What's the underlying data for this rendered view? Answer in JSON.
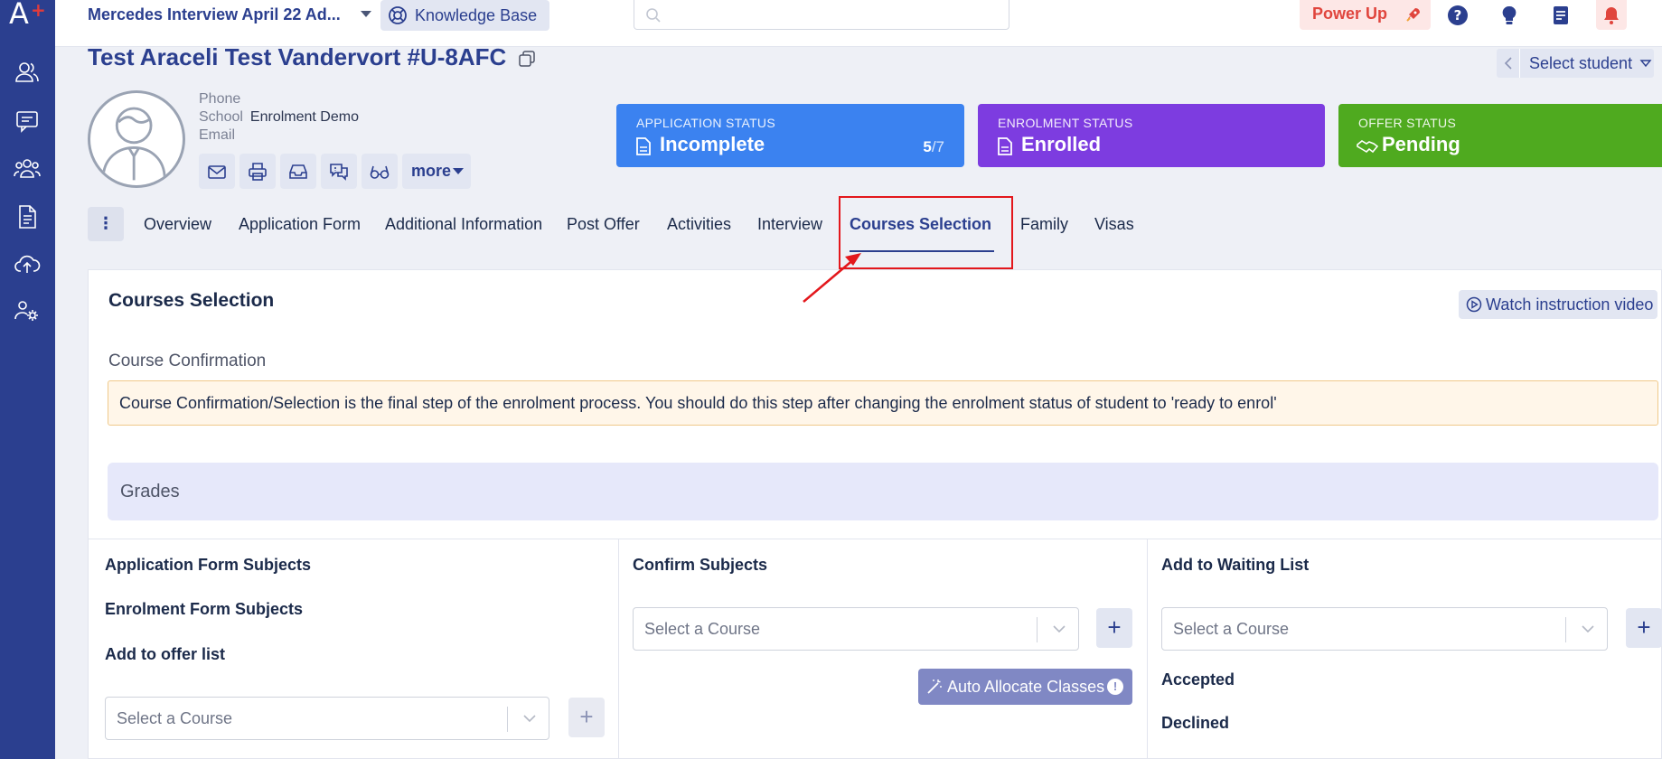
{
  "sidebar": {
    "logo": "A",
    "items": [
      "users-icon",
      "chat-icon",
      "group-icon",
      "document-icon",
      "cloud-upload-icon",
      "settings-users-icon"
    ]
  },
  "topbar": {
    "event_title": "Mercedes Interview April 22 Ad...",
    "knowledge_base": "Knowledge Base",
    "search_placeholder": "",
    "power_up": "Power Up"
  },
  "student": {
    "name": "Test Araceli Test Vandervort #U-8AFC",
    "select_student": "Select student",
    "phone_label": "Phone",
    "phone_value": "",
    "school_label": "School",
    "school_value": "Enrolment Demo",
    "email_label": "Email",
    "email_value": "",
    "more_label": "more"
  },
  "statuses": {
    "application": {
      "caption": "APPLICATION STATUS",
      "value": "Incomplete",
      "done": "5",
      "total": "/7",
      "color": "#3b82f0"
    },
    "enrolment": {
      "caption": "ENROLMENT STATUS",
      "value": "Enrolled",
      "color": "#7d3ce0"
    },
    "offer": {
      "caption": "OFFER STATUS",
      "value": "Pending",
      "color": "#4faa1f"
    }
  },
  "tabs": [
    {
      "label": "Overview"
    },
    {
      "label": "Application Form"
    },
    {
      "label": "Additional Information"
    },
    {
      "label": "Post Offer"
    },
    {
      "label": "Activities"
    },
    {
      "label": "Interview"
    },
    {
      "label": "Courses Selection",
      "active": true
    },
    {
      "label": "Family"
    },
    {
      "label": "Visas"
    }
  ],
  "panel": {
    "title": "Courses Selection",
    "watch_video": "Watch instruction video",
    "section_label": "Course Confirmation",
    "notice": "Course Confirmation/Selection is the final step of the enrolment process. You should do this step after changing the enrolment status of student to 'ready to enrol'",
    "grades": "Grades",
    "col1": {
      "app_form_subjects": "Application Form Subjects",
      "enrol_form_subjects": "Enrolment Form Subjects",
      "offer_list": "Add to offer list",
      "select_placeholder": "Select a Course"
    },
    "col2": {
      "heading": "Confirm Subjects",
      "select_placeholder": "Select a Course",
      "auto_allocate": "Auto Allocate Classes"
    },
    "col3": {
      "heading": "Add to Waiting List",
      "select_placeholder": "Select a Course",
      "accepted": "Accepted",
      "declined": "Declined"
    },
    "plus": "+"
  }
}
